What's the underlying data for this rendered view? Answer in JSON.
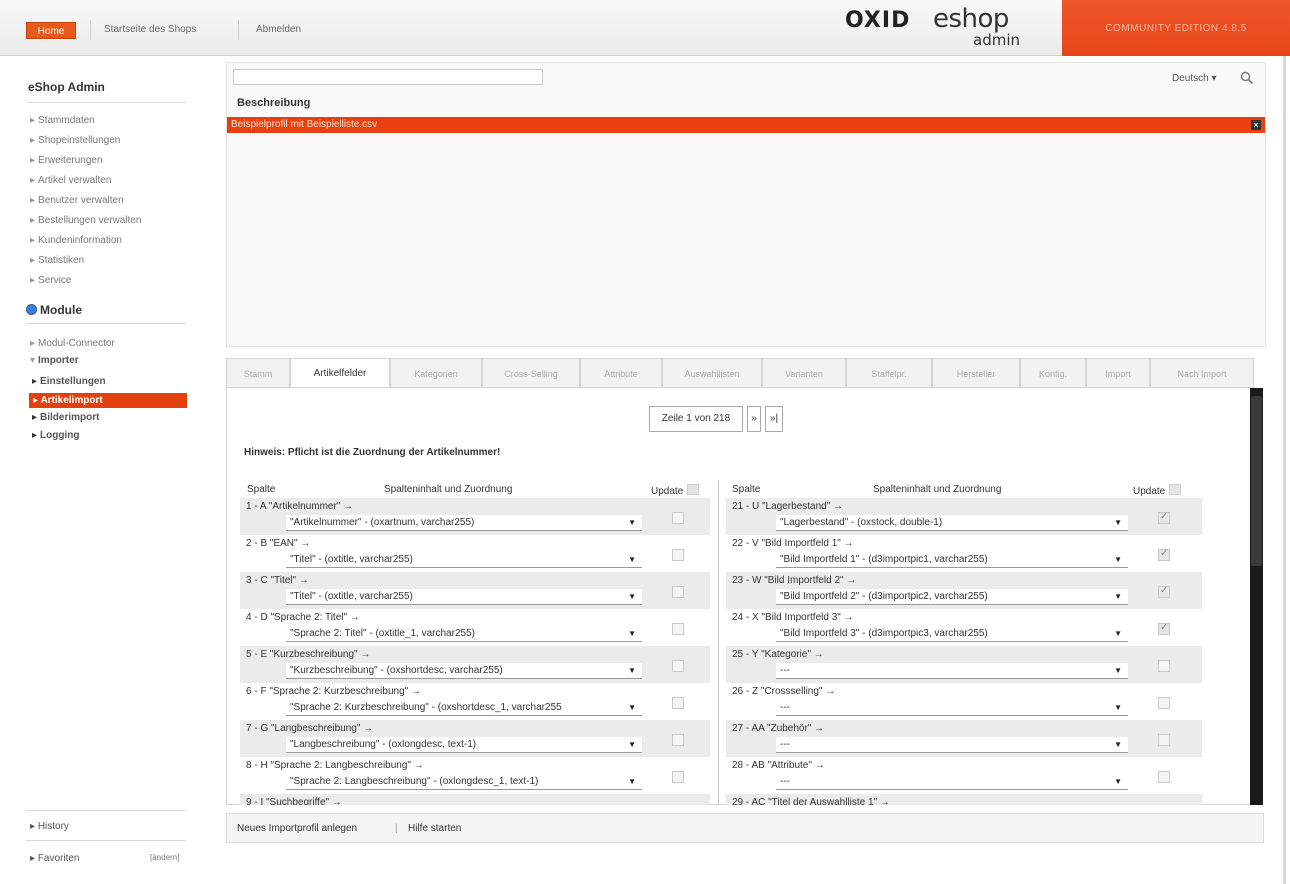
{
  "topbar": {
    "home": "Home",
    "link_shop": "Startseite des Shops",
    "link_logout": "Abmelden",
    "logo_oxid": "OXID",
    "logo_eshop": "eshop",
    "logo_admin": "admin",
    "edition": "COMMUNITY EDITION 4.8.5",
    "accent_color": "#e8410f"
  },
  "sidebar": {
    "title": "eShop Admin",
    "items": [
      "Stammdaten",
      "Shopeinstellungen",
      "Erweiterungen",
      "Artikel verwalten",
      "Benutzer verwalten",
      "Bestellungen verwalten",
      "Kundeninformation",
      "Statistiken",
      "Service"
    ],
    "module_title": "Module",
    "module_items": {
      "connector": "Modul-Connector",
      "importer": "Importer",
      "settings": "Einstellungen",
      "active": "Artikelimport",
      "images": "Bilderimport",
      "logging": "Logging"
    },
    "history": "History",
    "favorites": "Favoriten",
    "change": "[ändern]"
  },
  "list": {
    "search_placeholder": "",
    "language": "Deutsch",
    "column": "Beschreibung",
    "profile": "Beispielprofil mit Beispielliste.csv"
  },
  "tabs": [
    "Stamm",
    "Artikelfelder",
    "Kategorien",
    "Cross-Selling",
    "Attribute",
    "Auswahllisten",
    "Varianten",
    "Staffelpr.",
    "Hersteller",
    "Konfig.",
    "Import",
    "Nach Import"
  ],
  "pager": {
    "label": "Zeile 1 von 218",
    "next": "»",
    "last": "»|"
  },
  "hint": "Hinweis: Pflicht ist die Zuordnung der Artikelnummer!",
  "headers": {
    "spalte": "Spalte",
    "inhalt": "Spalteninhalt und Zuordnung",
    "update": "Update"
  },
  "left_rows": [
    {
      "col": "1 - A  \"Artikelnummer\" →",
      "sel": "\"Artikelnummer\" - (oxartnum, varchar255)",
      "checked": false
    },
    {
      "col": "2 - B  \"EAN\" →",
      "sel": "\"Titel\" - (oxtitle, varchar255)",
      "checked": false
    },
    {
      "col": "3 - C  \"Titel\" →",
      "sel": "\"Titel\" - (oxtitle, varchar255)",
      "checked": false
    },
    {
      "col": "4 - D  \"Sprache 2: Titel\" →",
      "sel": "\"Sprache 2: Titel\" - (oxtitle_1, varchar255)",
      "checked": false
    },
    {
      "col": "5 - E  \"Kurzbeschreibung\" →",
      "sel": "\"Kurzbeschreibung\" - (oxshortdesc, varchar255)",
      "checked": false
    },
    {
      "col": "6 - F  \"Sprache 2: Kurzbeschreibung\" →",
      "sel": "\"Sprache 2: Kurzbeschreibung\" - (oxshortdesc_1, varchar255",
      "checked": false
    },
    {
      "col": "7 - G  \"Langbeschreibung\" →",
      "sel": "\"Langbeschreibung\" - (oxlongdesc, text-1)",
      "checked": false
    },
    {
      "col": "8 - H  \"Sprache 2: Langbeschreibung\" →",
      "sel": "\"Sprache 2: Langbeschreibung\" - (oxlongdesc_1, text-1)",
      "checked": false
    },
    {
      "col": "9 - I  \"Suchbegriffe\" →",
      "sel": "",
      "checked": false
    }
  ],
  "right_rows": [
    {
      "col": "21 - U  \"Lagerbestand\" →",
      "sel": "\"Lagerbestand\" - (oxstock, double-1)",
      "checked": true
    },
    {
      "col": "22 - V  \"Bild Importfeld 1\" →",
      "sel": "\"Bild Importfeld 1\" - (d3importpic1, varchar255)",
      "checked": true
    },
    {
      "col": "23 - W  \"Bild Importfeld 2\" →",
      "sel": "\"Bild Importfeld 2\" - (d3importpic2, varchar255)",
      "checked": true
    },
    {
      "col": "24 - X  \"Bild Importfeld 3\" →",
      "sel": "\"Bild Importfeld 3\" - (d3importpic3, varchar255)",
      "checked": true
    },
    {
      "col": "25 - Y  \"Kategorie\" →",
      "sel": "---",
      "checked": false
    },
    {
      "col": "26 - Z  \"Crossselling\" →",
      "sel": "---",
      "checked": false
    },
    {
      "col": "27 - AA  \"Zubehör\" →",
      "sel": "---",
      "checked": false
    },
    {
      "col": "28 - AB  \"Attribute\" →",
      "sel": "---",
      "checked": false
    },
    {
      "col": "29 - AC  \"Titel der Auswahlliste 1\" →",
      "sel": "",
      "checked": false
    }
  ],
  "bottom": {
    "new_profile": "Neues Importprofil anlegen",
    "sep": "|",
    "help": "Hilfe starten"
  }
}
